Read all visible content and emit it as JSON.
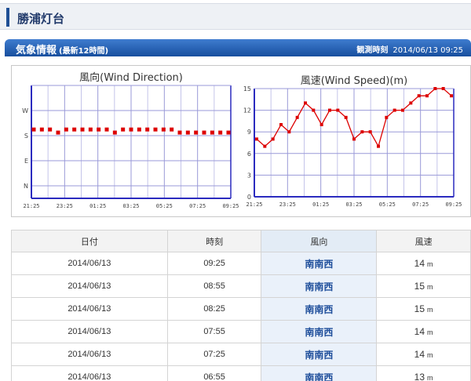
{
  "station": {
    "title": "勝浦灯台"
  },
  "weather": {
    "title": "気象情報",
    "subtitle": "(最新12時間)",
    "observed_label": "観測時刻",
    "observed_time": "2014/06/13 09:25"
  },
  "colors": {
    "header": "#2a63b5",
    "series": "#dd0000",
    "axis": "#2b2bbf"
  },
  "chart_data": [
    {
      "type": "scatter",
      "title": "風向(Wind Direction)",
      "x_ticks": [
        "21:25",
        "23:25",
        "01:25",
        "03:25",
        "05:25",
        "07:25",
        "09:25"
      ],
      "y_ticks": [
        "W",
        "S",
        "E",
        "N"
      ],
      "y_tick_values": [
        270,
        180,
        90,
        0
      ],
      "ylim": [
        -45,
        360
      ],
      "x": [
        0,
        1,
        2,
        3,
        4,
        5,
        6,
        7,
        8,
        9,
        10,
        11,
        12,
        13,
        14,
        15,
        16,
        17,
        18,
        19,
        20,
        21,
        22,
        23,
        24
      ],
      "values": [
        202,
        202,
        202,
        191,
        202,
        202,
        202,
        202,
        202,
        202,
        191,
        202,
        202,
        202,
        202,
        202,
        202,
        202,
        191,
        191,
        191,
        191,
        191,
        191,
        191
      ]
    },
    {
      "type": "line",
      "title": "風速(Wind Speed)(m)",
      "x_ticks": [
        "21:25",
        "23:25",
        "01:25",
        "03:25",
        "05:25",
        "07:25",
        "09:25"
      ],
      "y_ticks": [
        "15",
        "12",
        "9",
        "6",
        "3",
        "0"
      ],
      "y_tick_values": [
        15,
        12,
        9,
        6,
        3,
        0
      ],
      "ylim": [
        0,
        15
      ],
      "x": [
        0,
        1,
        2,
        3,
        4,
        5,
        6,
        7,
        8,
        9,
        10,
        11,
        12,
        13,
        14,
        15,
        16,
        17,
        18,
        19,
        20,
        21,
        22,
        23,
        24
      ],
      "values": [
        8,
        7,
        8,
        10,
        9,
        11,
        13,
        12,
        10,
        12,
        12,
        11,
        8,
        9,
        9,
        7,
        11,
        12,
        12,
        13,
        14,
        14,
        15,
        15,
        14
      ]
    }
  ],
  "table": {
    "headers": {
      "date": "日付",
      "time": "時刻",
      "direction": "風向",
      "speed": "風速"
    },
    "unit": "m",
    "rows": [
      {
        "date": "2014/06/13",
        "time": "09:25",
        "direction": "南南西",
        "speed": "14"
      },
      {
        "date": "2014/06/13",
        "time": "08:55",
        "direction": "南南西",
        "speed": "15"
      },
      {
        "date": "2014/06/13",
        "time": "08:25",
        "direction": "南南西",
        "speed": "15"
      },
      {
        "date": "2014/06/13",
        "time": "07:55",
        "direction": "南南西",
        "speed": "14"
      },
      {
        "date": "2014/06/13",
        "time": "07:25",
        "direction": "南南西",
        "speed": "14"
      },
      {
        "date": "2014/06/13",
        "time": "06:55",
        "direction": "南南西",
        "speed": "13"
      }
    ]
  }
}
